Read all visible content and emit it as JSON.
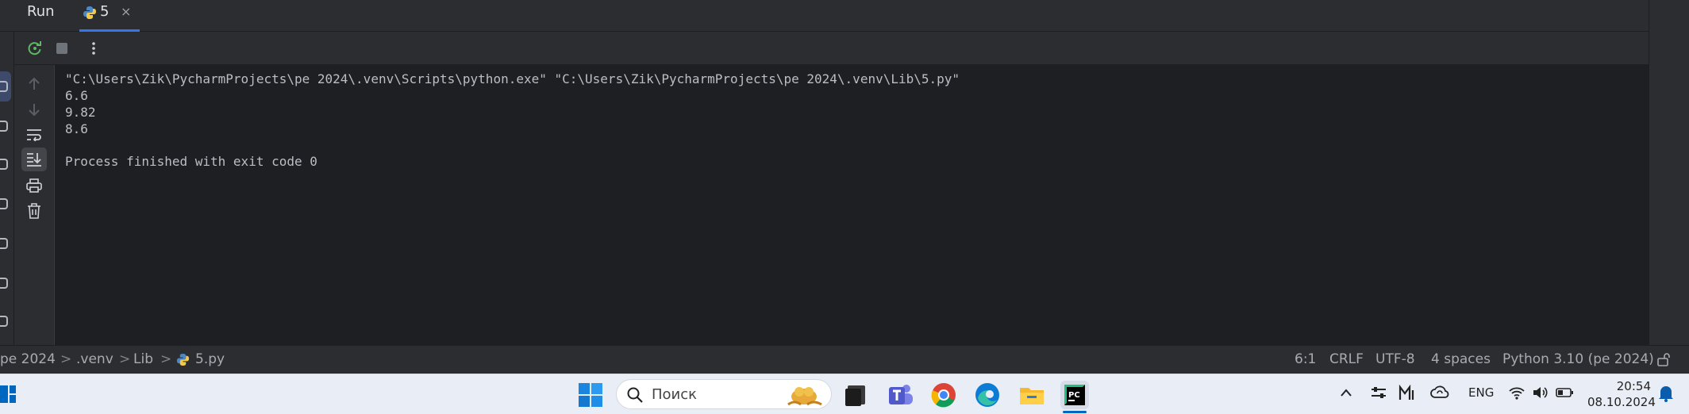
{
  "run_panel": {
    "title": "Run",
    "tab": {
      "label": "5",
      "close": "×"
    }
  },
  "console": {
    "lines": [
      "\"C:\\Users\\Zik\\PycharmProjects\\pe 2024\\.venv\\Scripts\\python.exe\" \"C:\\Users\\Zik\\PycharmProjects\\pe 2024\\.venv\\Lib\\5.py\"",
      "6.6",
      "9.82",
      "8.6",
      "",
      "Process finished with exit code 0"
    ]
  },
  "statusbar": {
    "breadcrumb": [
      "pe 2024",
      ".venv",
      "Lib",
      "5.py"
    ],
    "separator": ">",
    "position": "6:1",
    "line_ending": "CRLF",
    "encoding": "UTF-8",
    "indent": "4 spaces",
    "interpreter": "Python 3.10 (pe 2024)"
  },
  "taskbar": {
    "search_placeholder": "Поиск",
    "language": "ENG",
    "time": "20:54",
    "date": "08.10.2024"
  },
  "colors": {
    "accent": "#3574f0",
    "rerun": "#5fb865",
    "background": "#1e1f22",
    "panel": "#2b2d30"
  }
}
